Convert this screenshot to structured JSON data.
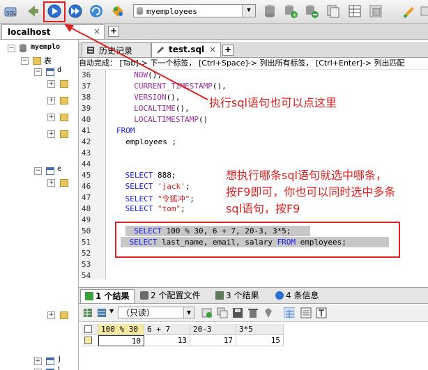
{
  "toolbar": {
    "database_select": "myemployees",
    "buttons": [
      "sql-icon",
      "back-icon",
      "run-icon",
      "run-all-icon",
      "refresh-icon",
      "schema-icon",
      "db-tool-icon",
      "db-add-icon",
      "db-remove-icon",
      "db-copy-icon",
      "grid-icon",
      "export-icon",
      "copy-icon",
      "brush-icon"
    ]
  },
  "connection": {
    "tab_label": "localhost",
    "close_glyph": "×",
    "new_tab_glyph": "+"
  },
  "tree": {
    "root": "myemplo",
    "tables_label": "表",
    "node_d": "d",
    "node_e": "e",
    "node_j": "j",
    "node_l": "l"
  },
  "editor": {
    "tabs": [
      {
        "label": "历史记录",
        "active": false
      },
      {
        "label": "test.sql",
        "active": true
      }
    ],
    "close_glyph": "×",
    "new_tab_glyph": "+",
    "info_line": "自动完成： [Tab]-> 下一个标签， [Ctrl+Space]-> 列出所有标签， [Ctrl+Enter]-> 列出匹配",
    "lines": [
      {
        "n": "36",
        "parts": [
          {
            "t": "  ",
            "c": ""
          },
          {
            "t": "NOW",
            "c": "fn"
          },
          {
            "t": "(),",
            "c": ""
          }
        ]
      },
      {
        "n": "37",
        "parts": [
          {
            "t": "  ",
            "c": ""
          },
          {
            "t": "CURRENT_TIMESTAMP",
            "c": "fn"
          },
          {
            "t": "(),",
            "c": ""
          }
        ]
      },
      {
        "n": "38",
        "parts": [
          {
            "t": "  ",
            "c": ""
          },
          {
            "t": "VERSION",
            "c": "fn"
          },
          {
            "t": "(),",
            "c": ""
          }
        ]
      },
      {
        "n": "39",
        "parts": [
          {
            "t": "  ",
            "c": ""
          },
          {
            "t": "LOCALTIME",
            "c": "fn"
          },
          {
            "t": "(),",
            "c": ""
          }
        ]
      },
      {
        "n": "40",
        "parts": [
          {
            "t": "  ",
            "c": ""
          },
          {
            "t": "LOCALTIMESTAMP",
            "c": "fn"
          },
          {
            "t": "()",
            "c": ""
          }
        ]
      },
      {
        "n": "41",
        "parts": [
          {
            "t": "FROM",
            "c": "kw"
          }
        ]
      },
      {
        "n": "42",
        "parts": [
          {
            "t": "  employees ;",
            "c": ""
          }
        ]
      },
      {
        "n": "43",
        "parts": []
      },
      {
        "n": "44",
        "parts": []
      },
      {
        "n": "45",
        "parts": [
          {
            "t": " ",
            "c": ""
          },
          {
            "t": "SELECT",
            "c": "kw"
          },
          {
            "t": " 888;",
            "c": ""
          }
        ]
      },
      {
        "n": "46",
        "parts": [
          {
            "t": " ",
            "c": ""
          },
          {
            "t": "SELECT",
            "c": "kw"
          },
          {
            "t": " ",
            "c": ""
          },
          {
            "t": "'jack'",
            "c": "st"
          },
          {
            "t": ";",
            "c": ""
          }
        ]
      },
      {
        "n": "47",
        "parts": [
          {
            "t": " ",
            "c": ""
          },
          {
            "t": "SELECT",
            "c": "kw"
          },
          {
            "t": " ",
            "c": ""
          },
          {
            "t": "\"令狐冲\"",
            "c": "st"
          },
          {
            "t": ";",
            "c": ""
          }
        ]
      },
      {
        "n": "48",
        "parts": [
          {
            "t": " ",
            "c": ""
          },
          {
            "t": "SELECT",
            "c": "kw"
          },
          {
            "t": " ",
            "c": ""
          },
          {
            "t": "\"tom\"",
            "c": "st"
          },
          {
            "t": ";",
            "c": ""
          }
        ]
      },
      {
        "n": "49",
        "parts": []
      },
      {
        "n": "50",
        "parts": [
          {
            "t": "  ",
            "c": ""
          },
          {
            "t": "SELECT",
            "c": "kw"
          },
          {
            "t": " 100 % 30, 6 + 7, 20-3, 3*5;",
            "c": ""
          }
        ]
      },
      {
        "n": "51",
        "parts": [
          {
            "t": " ",
            "c": ""
          },
          {
            "t": "SELECT",
            "c": "kw"
          },
          {
            "t": " last_name, email, salary ",
            "c": ""
          },
          {
            "t": "FROM",
            "c": "kw"
          },
          {
            "t": " employees;",
            "c": ""
          }
        ]
      },
      {
        "n": "52",
        "parts": []
      },
      {
        "n": "53",
        "parts": []
      },
      {
        "n": "54",
        "parts": []
      }
    ]
  },
  "annotations": {
    "top_note": "执行sql语句也可以点这里",
    "middle_note_line1": "想执行哪条sql语句就选中哪条，",
    "middle_note_line2": "按F9即可，你也可以同时选中多条",
    "middle_note_line3": "sql语句，按F9"
  },
  "results": {
    "tabs": [
      "1 个结果",
      "2 个配置文件",
      "3 个结果",
      "4 条信息"
    ],
    "readonly_select": "（只读）",
    "columns": [
      "100 % 30",
      "6 + 7",
      "20-3",
      "3*5"
    ],
    "rows": [
      [
        "10",
        "13",
        "17",
        "15"
      ]
    ]
  },
  "colors": {
    "annotation_red": "#e02020",
    "keyword_blue": "#1a1aff",
    "function_purple": "#9a2a9a",
    "string_red": "#d42020",
    "selection_gray": "#c7c7c7"
  }
}
